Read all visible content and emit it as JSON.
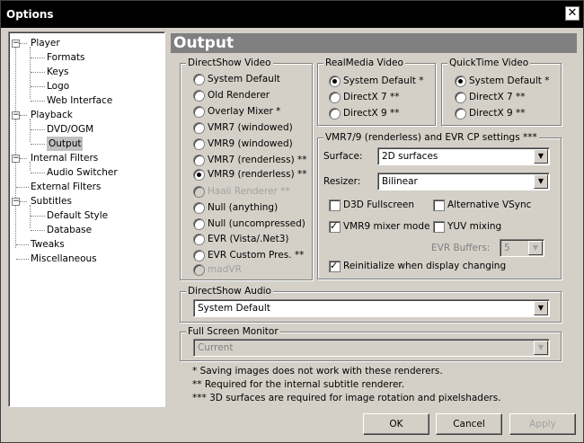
{
  "window": {
    "title": "Options",
    "close_glyph": "✕"
  },
  "tree": [
    {
      "label": "Player",
      "box": "−"
    },
    {
      "label": "Formats"
    },
    {
      "label": "Keys"
    },
    {
      "label": "Logo"
    },
    {
      "label": "Web Interface"
    },
    {
      "label": "Playback",
      "box": "−"
    },
    {
      "label": "DVD/OGM"
    },
    {
      "label": "Output",
      "selected": true
    },
    {
      "label": "Internal Filters",
      "box": "−"
    },
    {
      "label": "Audio Switcher"
    },
    {
      "label": "External Filters"
    },
    {
      "label": "Subtitles",
      "box": "−"
    },
    {
      "label": "Default Style"
    },
    {
      "label": "Database"
    },
    {
      "label": "Tweaks"
    },
    {
      "label": "Miscellaneous"
    }
  ],
  "page": {
    "title": "Output"
  },
  "directshow_video": {
    "label": "DirectShow Video",
    "options": [
      {
        "label": "System Default",
        "checked": false,
        "enabled": true
      },
      {
        "label": "Old Renderer",
        "checked": false,
        "enabled": true
      },
      {
        "label": "Overlay Mixer *",
        "checked": false,
        "enabled": true
      },
      {
        "label": "VMR7 (windowed)",
        "checked": false,
        "enabled": true
      },
      {
        "label": "VMR9 (windowed)",
        "checked": false,
        "enabled": true
      },
      {
        "label": "VMR7 (renderless) **",
        "checked": false,
        "enabled": true
      },
      {
        "label": "VMR9 (renderless) **",
        "checked": true,
        "enabled": true
      },
      {
        "label": "Haali Renderer **",
        "checked": false,
        "enabled": false
      },
      {
        "label": "Null (anything)",
        "checked": false,
        "enabled": true
      },
      {
        "label": "Null (uncompressed)",
        "checked": false,
        "enabled": true
      },
      {
        "label": "EVR (Vista/.Net3)",
        "checked": false,
        "enabled": true
      },
      {
        "label": "EVR Custom Pres. **",
        "checked": false,
        "enabled": true
      },
      {
        "label": "madVR",
        "checked": false,
        "enabled": false
      }
    ]
  },
  "realmedia_video": {
    "label": "RealMedia Video",
    "options": [
      {
        "label": "System Default *",
        "checked": true
      },
      {
        "label": "DirectX 7 **",
        "checked": false
      },
      {
        "label": "DirectX 9 **",
        "checked": false
      }
    ]
  },
  "quicktime_video": {
    "label": "QuickTime Video",
    "options": [
      {
        "label": "System Default *",
        "checked": true
      },
      {
        "label": "DirectX 7 **",
        "checked": false
      },
      {
        "label": "DirectX 9 **",
        "checked": false
      }
    ]
  },
  "vmr_settings": {
    "label": "VMR7/9 (renderless) and EVR CP settings ***",
    "surface_label": "Surface:",
    "surface_value": "2D surfaces",
    "resizer_label": "Resizer:",
    "resizer_value": "Bilinear",
    "d3d_fullscreen": "D3D Fullscreen",
    "alt_vsync": "Alternative VSync",
    "vmr9_mixer": "VMR9 mixer mode",
    "yuv_mixing": "YUV mixing",
    "evr_buffers_label": "EVR Buffers:",
    "evr_buffers_value": "5",
    "reinit": "Reinitialize when display changing"
  },
  "directshow_audio": {
    "label": "DirectShow Audio",
    "value": "System Default"
  },
  "fullscreen_monitor": {
    "label": "Full Screen Monitor",
    "value": "Current"
  },
  "notes": [
    "* Saving images does not work with these renderers.",
    "** Required for the internal subtitle renderer.",
    "*** 3D surfaces are required for image rotation and pixelshaders."
  ],
  "buttons": {
    "ok": "OK",
    "cancel": "Cancel",
    "apply": "Apply"
  },
  "dropdown_arrow": "▼"
}
